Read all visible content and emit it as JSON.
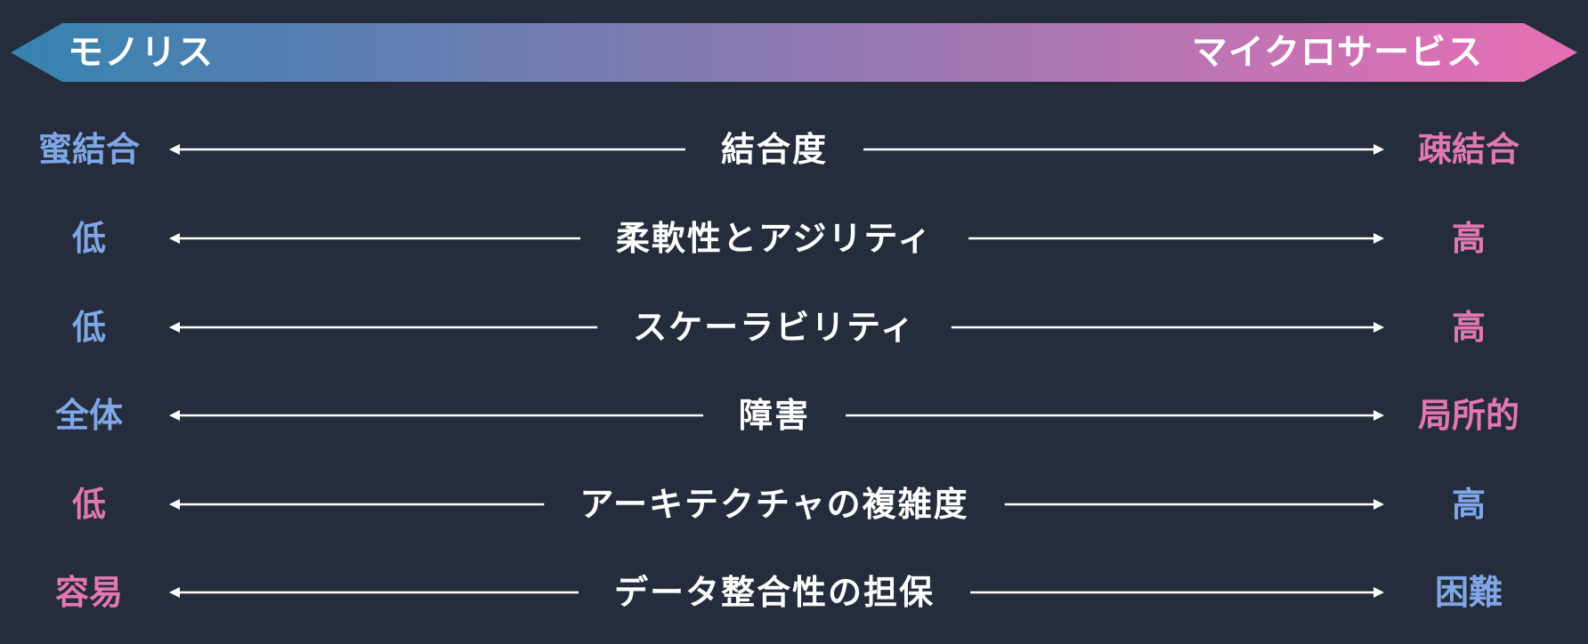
{
  "banner": {
    "left_label": "モノリス",
    "right_label": "マイクロサービス",
    "gradient_start": "#3583b0",
    "gradient_end": "#e76fb4"
  },
  "colors": {
    "blue": "#7fa6e6",
    "pink": "#e377b4",
    "text": "#ffffff",
    "background": "#252d3c"
  },
  "rows": [
    {
      "label": "結合度",
      "left": "蜜結合",
      "right": "疎結合",
      "left_color": "blue",
      "right_color": "pink"
    },
    {
      "label": "柔軟性とアジリティ",
      "left": "低",
      "right": "高",
      "left_color": "blue",
      "right_color": "pink"
    },
    {
      "label": "スケーラビリティ",
      "left": "低",
      "right": "高",
      "left_color": "blue",
      "right_color": "pink"
    },
    {
      "label": "障害",
      "left": "全体",
      "right": "局所的",
      "left_color": "blue",
      "right_color": "pink"
    },
    {
      "label": "アーキテクチャの複雑度",
      "left": "低",
      "right": "高",
      "left_color": "pink",
      "right_color": "blue"
    },
    {
      "label": "データ整合性の担保",
      "left": "容易",
      "right": "困難",
      "left_color": "pink",
      "right_color": "blue"
    }
  ]
}
